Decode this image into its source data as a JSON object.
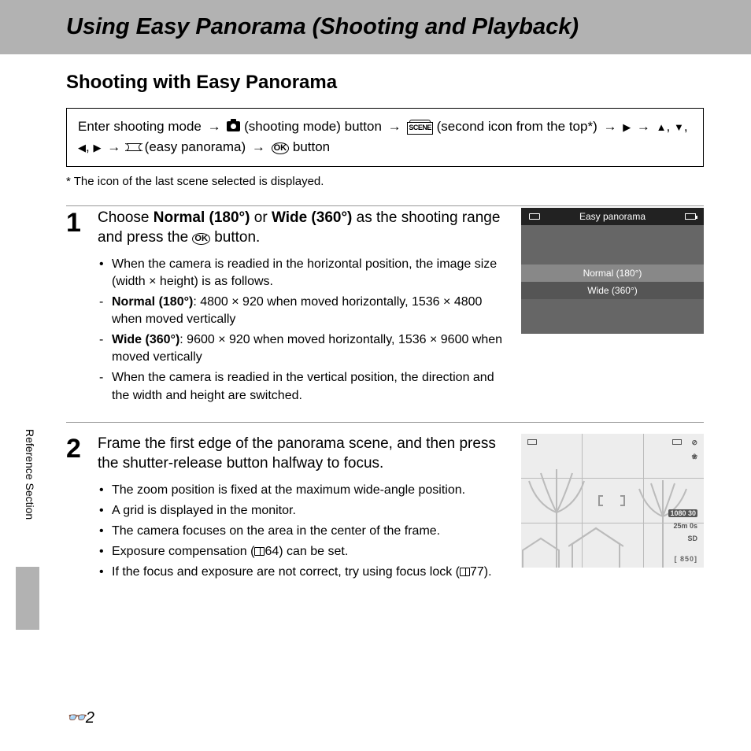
{
  "page_title": "Using Easy Panorama (Shooting and Playback)",
  "section_title": "Shooting with Easy Panorama",
  "instruction": {
    "p1": "Enter shooting mode ",
    "p2": " (shooting mode) button ",
    "p3": " (second icon from the top*) ",
    "p4": " (easy panorama) ",
    "p5": " button"
  },
  "footnote": "The icon of the last scene selected is displayed.",
  "steps": [
    {
      "num": "1",
      "heading_parts": {
        "a": "Choose ",
        "b": "Normal (180°)",
        "c": " or ",
        "d": "Wide (360°)",
        "e": " as the shooting range and press the ",
        "f": " button."
      },
      "bullets": [
        "When the camera is readied in the horizontal position, the image size (width × height) is as follows."
      ],
      "dashes": [
        {
          "b": "Normal (180°)",
          "t": ": 4800 × 920 when moved horizontally, 1536 × 4800 when moved vertically"
        },
        {
          "b": "Wide (360°)",
          "t": ": 9600 × 920 when moved horizontally, 1536 × 9600 when moved vertically"
        },
        {
          "b": "",
          "t": "When the camera is readied in the vertical position, the direction and the width and height are switched."
        }
      ],
      "screen": {
        "title": "Easy panorama",
        "opt1": "Normal (180°)",
        "opt2": "Wide (360°)"
      }
    },
    {
      "num": "2",
      "heading": "Frame the first edge of the panorama scene, and then press the shutter-release button halfway to focus.",
      "bullets": [
        "The zoom position is fixed at the maximum wide-angle position.",
        "A grid is displayed in the monitor.",
        "The camera focuses on the area in the center of the frame.",
        "Exposure compensation (📖64) can be set.",
        "If the focus and exposure are not correct, try using focus lock (📖77)."
      ],
      "hud": {
        "rec": "25m 0s",
        "shots": "[  850]",
        "res": "1080 30"
      }
    }
  ],
  "side_label": "Reference Section",
  "page_number": "2"
}
